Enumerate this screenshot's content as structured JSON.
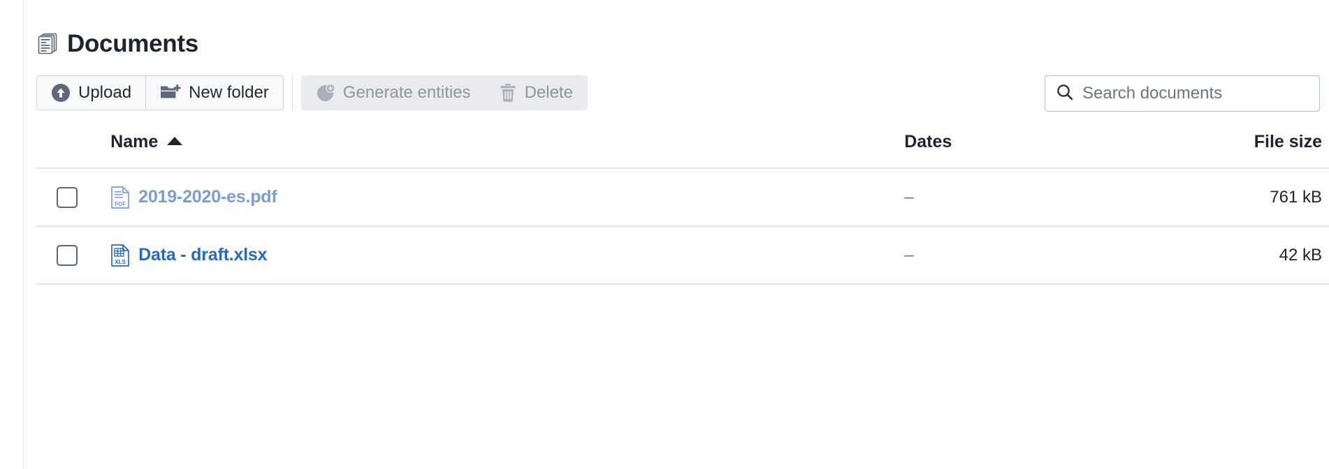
{
  "page": {
    "title": "Documents",
    "title_icon": "documents-stack-icon"
  },
  "toolbar": {
    "primary_actions": [
      {
        "id": "upload",
        "label": "Upload",
        "icon": "upload-circle-icon",
        "disabled": false
      },
      {
        "id": "new-folder",
        "label": "New folder",
        "icon": "folder-plus-icon",
        "disabled": false
      }
    ],
    "secondary_actions": [
      {
        "id": "generate-entities",
        "label": "Generate entities",
        "icon": "person-plus-circle-icon",
        "disabled": true
      },
      {
        "id": "delete",
        "label": "Delete",
        "icon": "trash-icon",
        "disabled": true
      }
    ]
  },
  "search": {
    "icon": "search-icon",
    "placeholder": "Search documents",
    "value": ""
  },
  "table": {
    "columns": {
      "name": "Name",
      "dates": "Dates",
      "size": "File size"
    },
    "sort": {
      "column": "Name",
      "direction": "asc",
      "indicator": "▲"
    },
    "rows": [
      {
        "checked": false,
        "icon": "pdf-file-icon",
        "icon_label": "PDF",
        "name": "2019-2020-es.pdf",
        "link_state": "visited",
        "dates": "–",
        "size": "761 kB"
      },
      {
        "checked": false,
        "icon": "xls-file-icon",
        "icon_label": "XLS",
        "name": "Data - draft.xlsx",
        "link_state": "normal",
        "dates": "–",
        "size": "42 kB"
      }
    ]
  },
  "colors": {
    "link_visited": "#7e9ccd",
    "link_normal": "#2c69b8",
    "text": "#1d242e",
    "muted": "#6d7684",
    "disabled_bg": "#e9ebee",
    "disabled_text": "#8d96a3",
    "border": "#e4e7ea"
  }
}
